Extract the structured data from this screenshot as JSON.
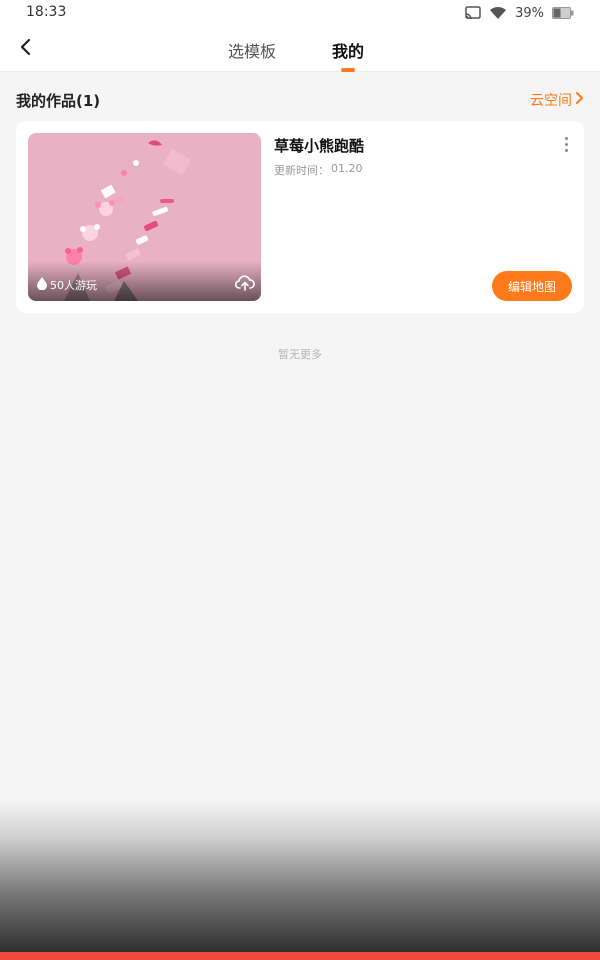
{
  "status_bar": {
    "time": "18:33",
    "battery": "39%"
  },
  "nav": {
    "tabs": [
      {
        "label": "选模板",
        "active": false
      },
      {
        "label": "我的",
        "active": true
      }
    ]
  },
  "section": {
    "title": "我的作品(1)",
    "cloud_link": "云空间"
  },
  "works": [
    {
      "title": "草莓小熊跑酷",
      "updated_label": "更新时间：",
      "updated_value": "01.20",
      "plays": "50人游玩",
      "edit_label": "编辑地图"
    }
  ],
  "footer_text": "暂无更多",
  "colors": {
    "accent": "#ff7a1a",
    "thumbnail_bg": "#e9b2c4",
    "bottom_bar": "#ef4a3c"
  },
  "icons": [
    "cast-icon",
    "wifi-icon",
    "battery-icon",
    "back-arrow-icon",
    "chevron-right-icon",
    "more-vertical-icon",
    "drop-icon",
    "cloud-upload-icon"
  ]
}
